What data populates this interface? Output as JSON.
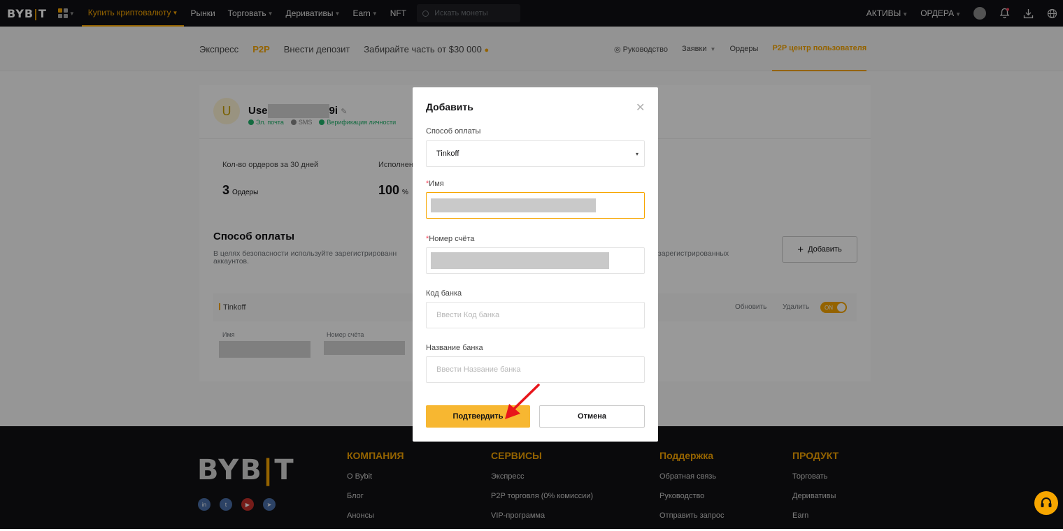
{
  "topbar": {
    "logo": "BYB|T",
    "nav": [
      {
        "label": "Купить криптовалюту",
        "active": true,
        "caret": true
      },
      {
        "label": "Рынки",
        "caret": false
      },
      {
        "label": "Торговать",
        "caret": true
      },
      {
        "label": "Деривативы",
        "caret": true
      },
      {
        "label": "Earn",
        "caret": true
      },
      {
        "label": "NFT",
        "caret": false
      }
    ],
    "search_placeholder": "Искать монеты",
    "assets": "АКТИВЫ",
    "orders": "ОРДЕРА"
  },
  "subnav": {
    "left": [
      "Экспресс",
      "P2P",
      "Внести депозит",
      "Забирайте часть от $30 000"
    ],
    "guide": "Руководство",
    "requests": "Заявки",
    "orders": "Ордеры",
    "center": "P2P центр пользователя"
  },
  "profile": {
    "avatar_letter": "U",
    "name_start": "Use",
    "name_end": "9i",
    "badges": {
      "email": "Эл. почта",
      "sms": "SMS",
      "kyc": "Верификация личности"
    },
    "stat1_label": "Кол-во ордеров за 30 дней",
    "stat1_value": "3",
    "stat1_unit": "Ордеры",
    "stat2_label": "Исполнен",
    "stat2_value": "100",
    "stat2_unit": "%"
  },
  "payment": {
    "title": "Способ оплаты",
    "desc_left": "В целях безопасности используйте зарегистрированн",
    "desc_right": "ых зарегистрированных",
    "desc_line2": "аккаунтов.",
    "add_label": "Добавить",
    "method_name": "Tinkoff",
    "update": "Обновить",
    "delete": "Удалить",
    "toggle": "ON",
    "col_name": "Имя",
    "col_account": "Номер счёта"
  },
  "modal": {
    "title": "Добавить",
    "method_label": "Способ оплаты",
    "method_value": "Tinkoff",
    "name_label": "Имя",
    "account_label": "Номер счёта",
    "bank_code_label": "Код банка",
    "bank_code_placeholder": "Ввести Код банка",
    "bank_name_label": "Название банка",
    "bank_name_placeholder": "Ввести Название банка",
    "confirm": "Подтвердить",
    "cancel": "Отмена"
  },
  "footer": {
    "logo": "BYB|T",
    "cols": [
      {
        "head": "КОМПАНИЯ",
        "items": [
          "О Bybit",
          "Блог",
          "Анонсы"
        ]
      },
      {
        "head": "СЕРВИСЫ",
        "items": [
          "Экспресс",
          "P2P торговля (0% комиссии)",
          "VIP-программа"
        ]
      },
      {
        "head": "Поддержка",
        "items": [
          "Обратная связь",
          "Руководство",
          "Отправить запрос"
        ]
      },
      {
        "head": "ПРОДУКТ",
        "items": [
          "Торговать",
          "Деривативы",
          "Earn"
        ]
      }
    ]
  },
  "colors": {
    "brand": "#f7a600",
    "bg_dark": "#101014",
    "success": "#20b26c",
    "required": "#f6465d"
  }
}
